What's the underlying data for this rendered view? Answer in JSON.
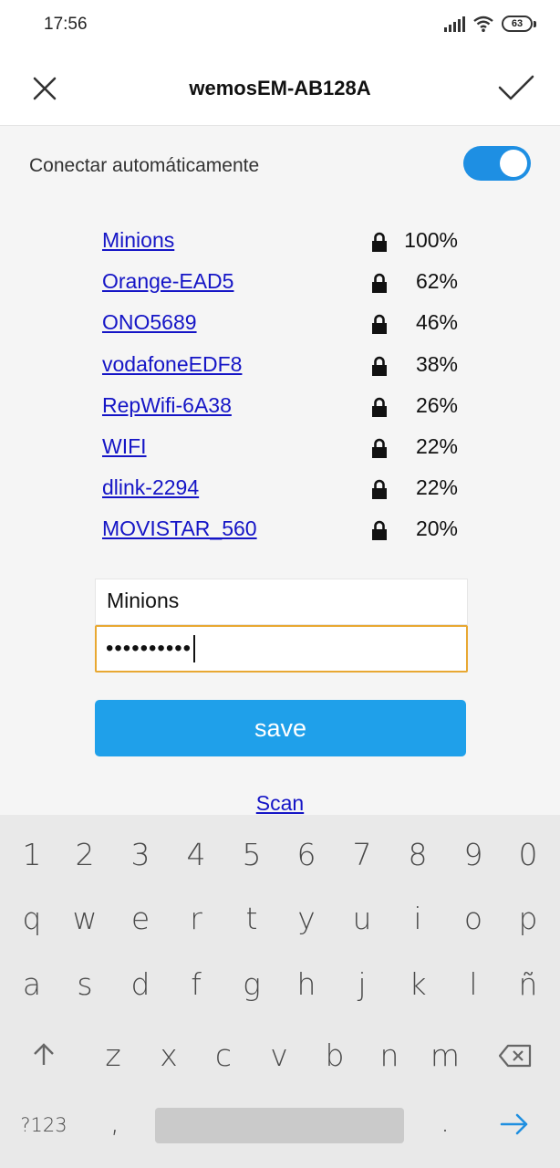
{
  "status": {
    "time": "17:56",
    "battery": "63"
  },
  "header": {
    "title": "wemosEM-AB128A"
  },
  "auto_connect": {
    "label": "Conectar automáticamente",
    "enabled": true
  },
  "networks": [
    {
      "ssid": "Minions",
      "signal": "100%"
    },
    {
      "ssid": "Orange-EAD5",
      "signal": "62%"
    },
    {
      "ssid": "ONO5689",
      "signal": "46%"
    },
    {
      "ssid": "vodafoneEDF8",
      "signal": "38%"
    },
    {
      "ssid": "RepWifi-6A38",
      "signal": "26%"
    },
    {
      "ssid": "WIFI",
      "signal": "22%"
    },
    {
      "ssid": "dlink-2294",
      "signal": "22%"
    },
    {
      "ssid": "MOVISTAR_560",
      "signal": "20%"
    }
  ],
  "form": {
    "ssid_value": "Minions",
    "password_masked": "••••••••••",
    "save_label": "save",
    "scan_label": "Scan"
  },
  "keyboard": {
    "row_numbers": [
      "1",
      "2",
      "3",
      "4",
      "5",
      "6",
      "7",
      "8",
      "9",
      "0"
    ],
    "row1": [
      "q",
      "w",
      "e",
      "r",
      "t",
      "y",
      "u",
      "i",
      "o",
      "p"
    ],
    "row2": [
      "a",
      "s",
      "d",
      "f",
      "g",
      "h",
      "j",
      "k",
      "l",
      "ñ"
    ],
    "row3": [
      "z",
      "x",
      "c",
      "v",
      "b",
      "n",
      "m"
    ],
    "symbols_label": "?123",
    "comma": ",",
    "period": "."
  },
  "colors": {
    "accent": "#1fa0ea",
    "toggle": "#1e8fe3",
    "link": "#1515c6",
    "focus_border": "#e8a832"
  }
}
